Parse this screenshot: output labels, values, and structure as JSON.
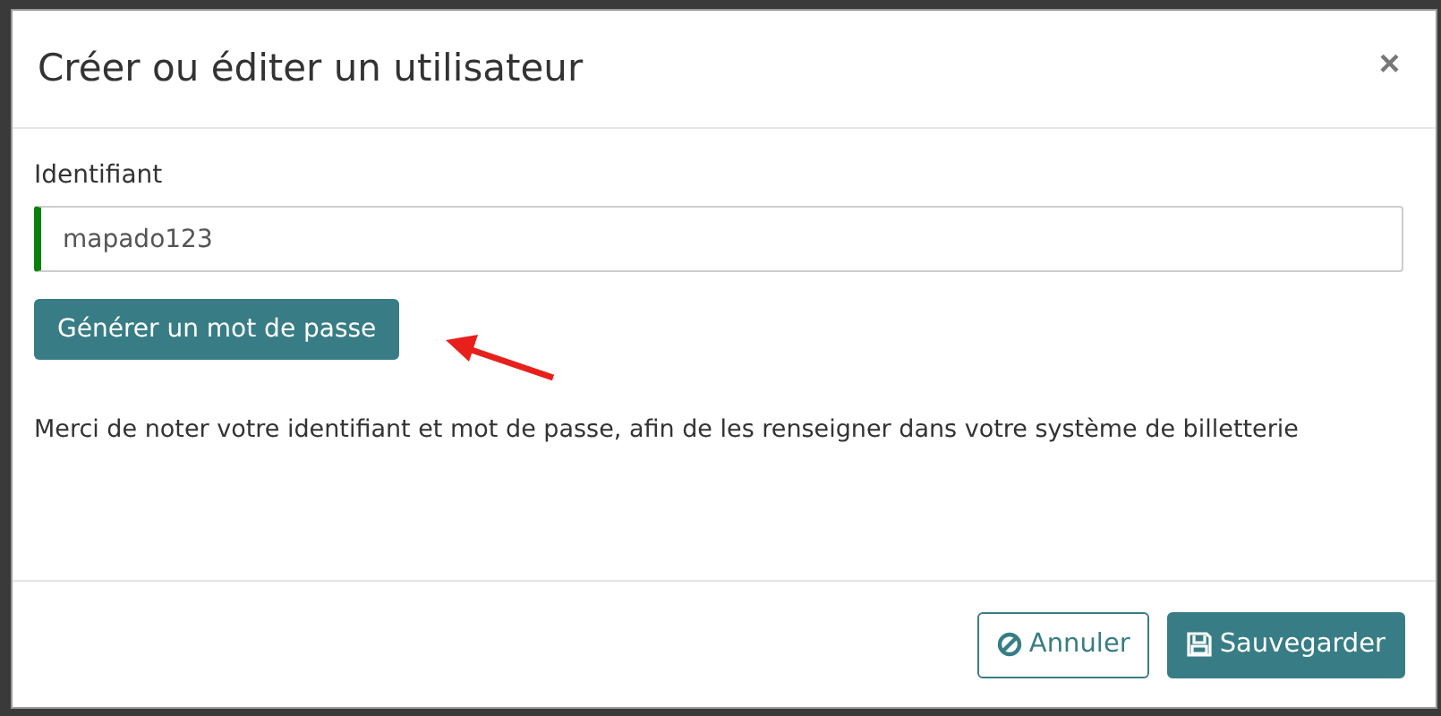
{
  "dialog": {
    "title": "Créer ou éditer un utilisateur",
    "close": "×"
  },
  "field": {
    "label": "Identifiant",
    "value": "mapado123",
    "valid": true
  },
  "generate_button": "Générer un mot de passe",
  "note": "Merci de noter votre identifiant et mot de passe, afin de les renseigner dans votre système de billetterie",
  "buttons": [
    {
      "kind": "cancel",
      "label": "Annuler"
    },
    {
      "kind": "save",
      "label": "Sauvegarder"
    }
  ]
}
